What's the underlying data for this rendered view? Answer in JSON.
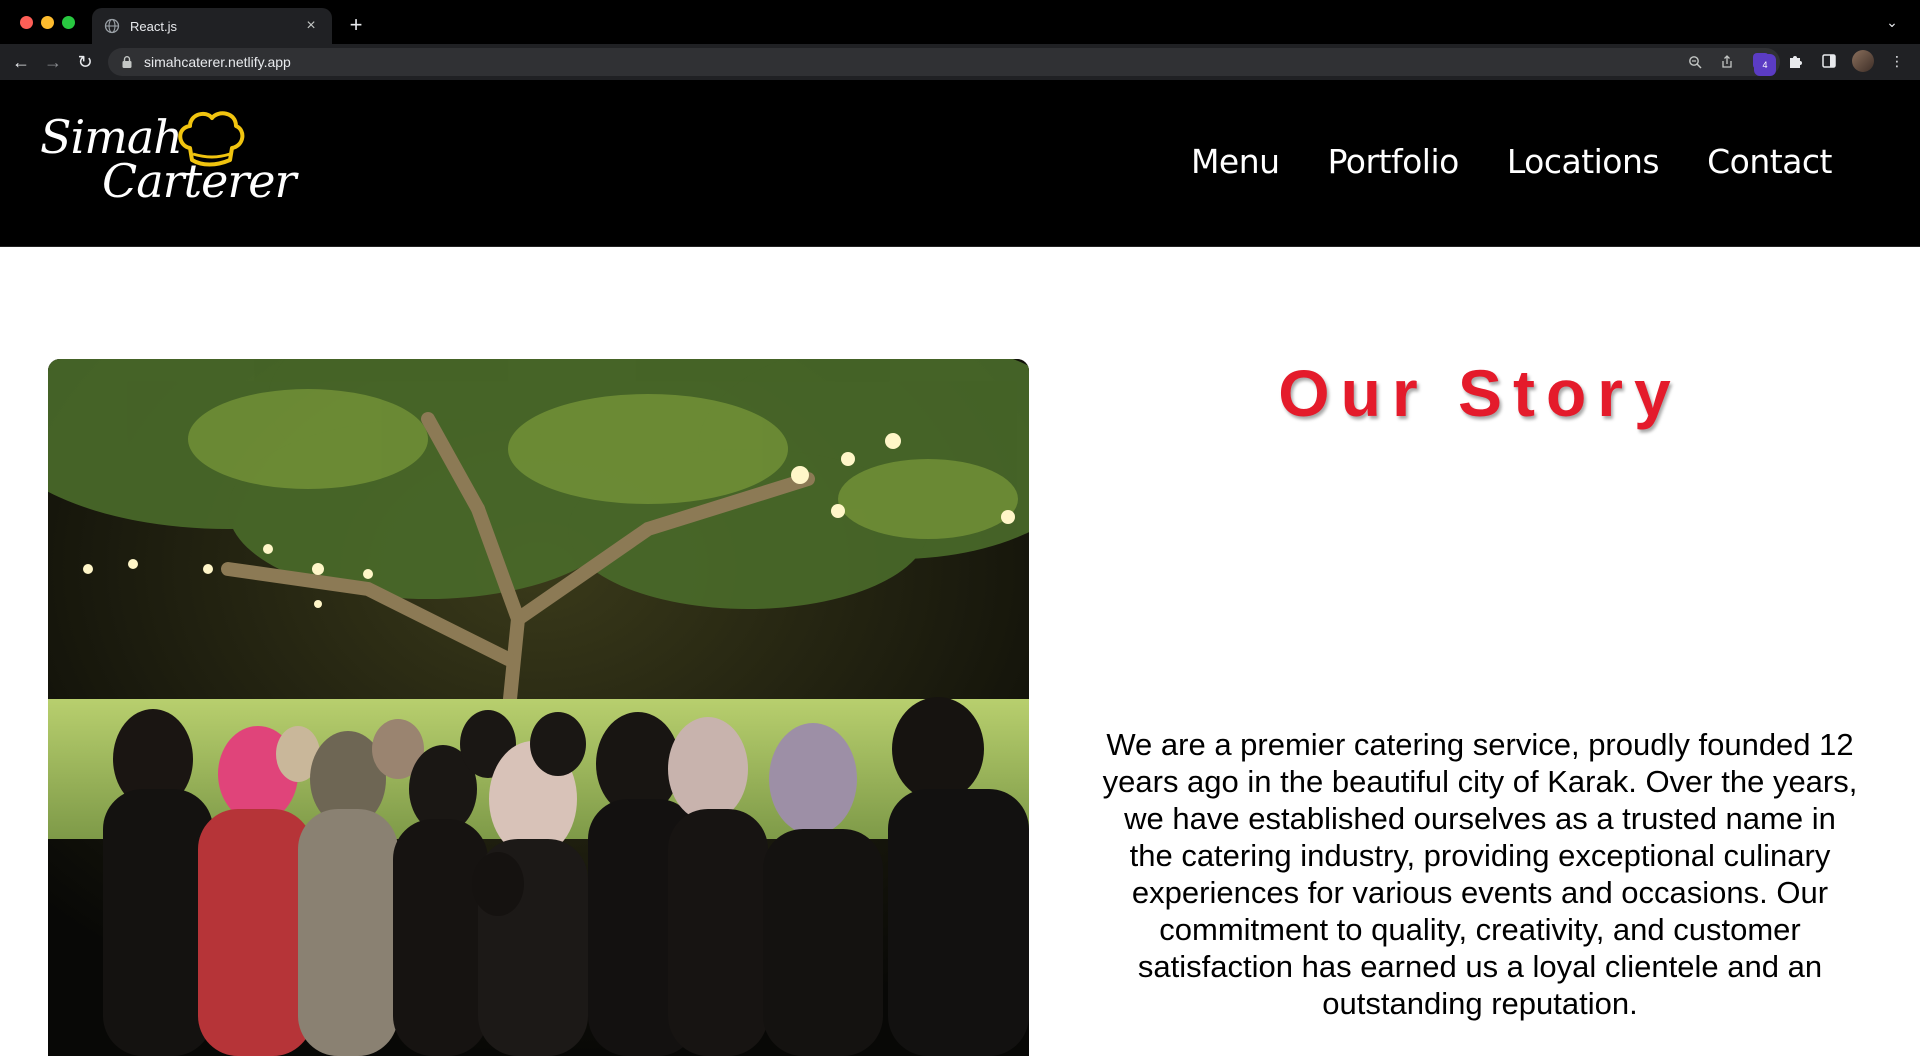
{
  "browser": {
    "tab_title": "React.js",
    "url": "simahcaterer.netlify.app",
    "extension_badge_count": "4"
  },
  "site": {
    "logo_line1": "Simah",
    "logo_line2": "Carterer",
    "nav": [
      {
        "label": "Menu"
      },
      {
        "label": "Portfolio"
      },
      {
        "label": "Locations"
      },
      {
        "label": "Contact"
      }
    ]
  },
  "story": {
    "title": "Our Story",
    "body": "We are a premier catering service, proudly founded 12 years ago in the beautiful city of Karak. Over the years, we have established ourselves as a trusted name in the catering industry, providing exceptional culinary experiences for various events and occasions. Our commitment to quality, creativity, and customer satisfaction has earned us a loyal clientele and an outstanding reputation."
  },
  "colors": {
    "title_red": "#e41b2b",
    "header_bg": "#000000",
    "hat_gold": "#f1c40f"
  },
  "icons": {
    "tab_favicon": "globe-icon",
    "close": "close-icon",
    "new_tab": "plus-icon",
    "back": "arrow-left-icon",
    "forward": "arrow-right-icon",
    "reload": "reload-icon",
    "lock": "lock-icon",
    "zoom": "zoom-icon",
    "share": "share-icon",
    "bookmark": "star-icon",
    "extensions": "puzzle-icon",
    "sidepanel": "sidepanel-icon",
    "chef_hat": "chef-hat-icon"
  }
}
